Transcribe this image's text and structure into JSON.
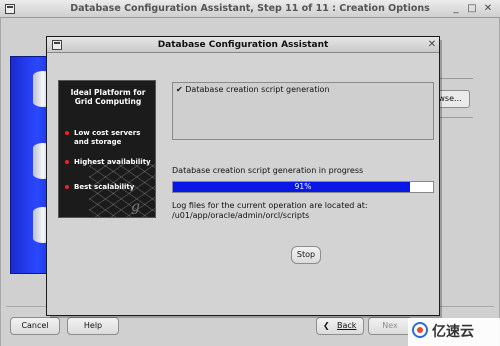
{
  "window": {
    "title": "Database Configuration Assistant, Step 11 of 11 : Creation Options"
  },
  "background": {
    "browse_label": "wse...",
    "buttons": {
      "cancel": "Cancel",
      "help": "Help",
      "back": "Back",
      "next": "Nex"
    }
  },
  "dialog": {
    "title": "Database Configuration Assistant",
    "promo": {
      "title": "Ideal Platform for Grid Computing",
      "items": [
        "Low cost servers and storage",
        "Highest availability",
        "Best scalability"
      ],
      "mark": "g"
    },
    "task": {
      "check": "✔",
      "label": "Database creation script generation"
    },
    "status": "Database creation script generation in progress",
    "progress": {
      "percent": 91,
      "label": "91%"
    },
    "log_line1": "Log files for the current operation are located at:",
    "log_line2": "/u01/app/oracle/admin/orcl/scripts",
    "stop_label": "Stop"
  },
  "watermark": {
    "text": "亿速云"
  },
  "colors": {
    "progress_fill": "#0a18e6",
    "db_image_blue": "#2b48ff",
    "promo_bullet": "#e22222"
  },
  "icons": [
    "window-menu-icon",
    "minimize-icon",
    "maximize-icon",
    "close-icon",
    "check-icon",
    "database-cylinder-icon"
  ]
}
